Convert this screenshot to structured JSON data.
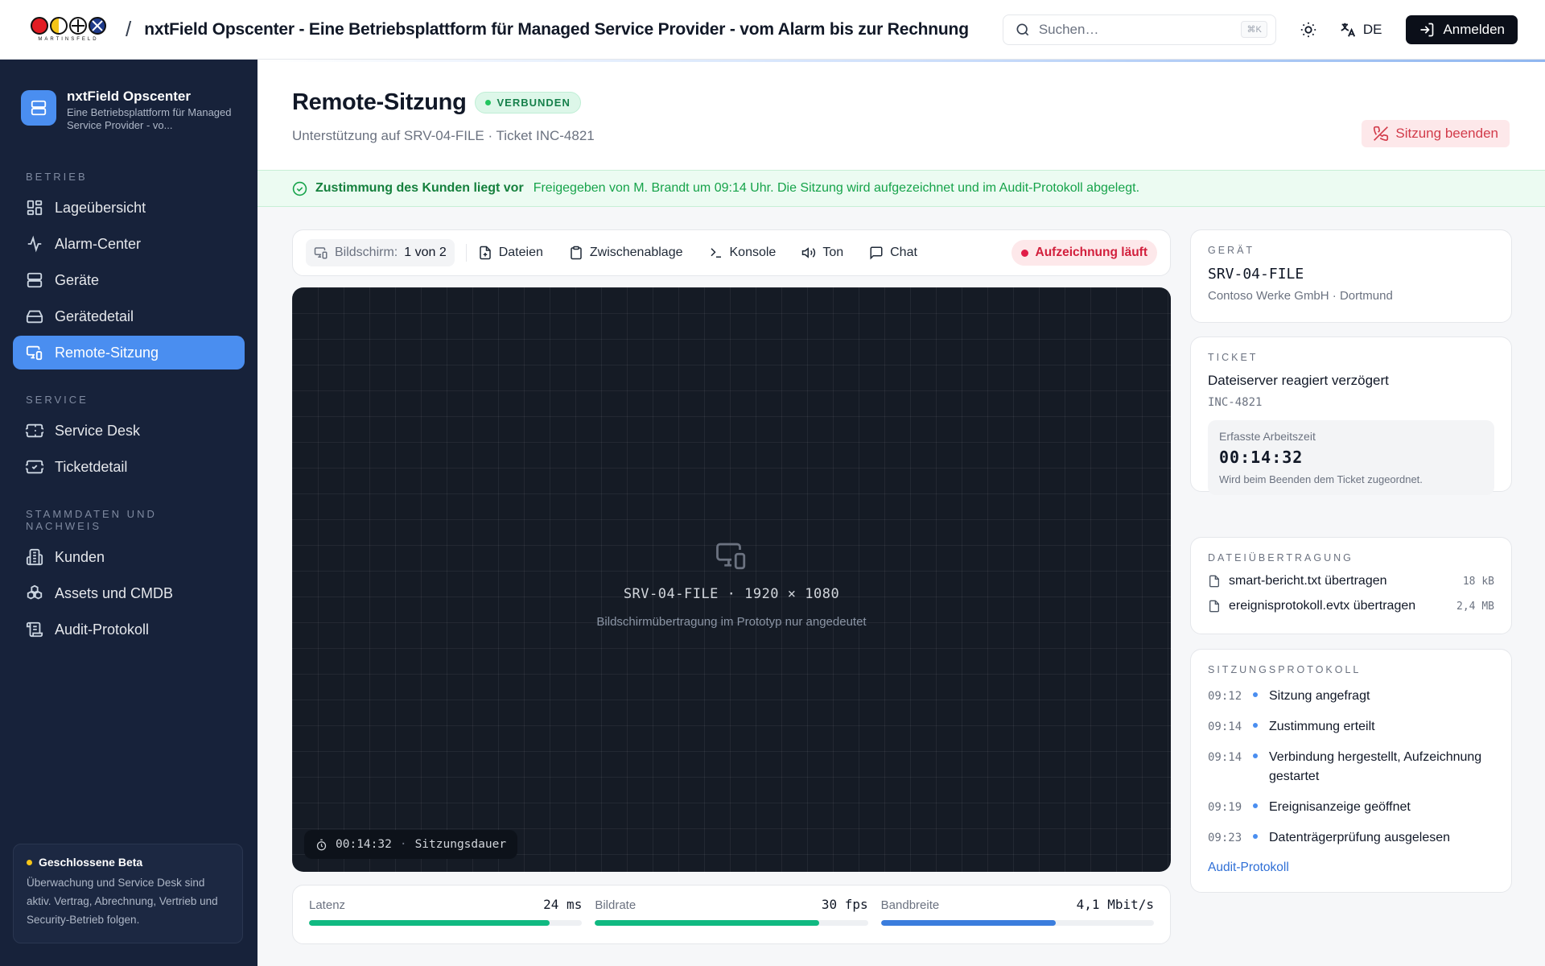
{
  "topbar": {
    "logo_text": "MARTINSFELD",
    "title": "nxtField Opscenter - Eine Betriebsplattform für Managed Service Provider - vom Alarm bis zur Rechnung",
    "search_placeholder": "Suchen…",
    "search_shortcut": "⌘K",
    "language": "DE",
    "login_label": "Anmelden"
  },
  "sidebar": {
    "brand_title": "nxtField Opscenter",
    "brand_subtitle": "Eine Betriebsplattform für Managed Service Provider - vo...",
    "sections": [
      {
        "title": "BETRIEB",
        "items": [
          {
            "label": "Lageübersicht",
            "icon": "dashboard-icon"
          },
          {
            "label": "Alarm-Center",
            "icon": "activity-icon"
          },
          {
            "label": "Geräte",
            "icon": "server-icon"
          },
          {
            "label": "Gerätedetail",
            "icon": "drive-icon"
          },
          {
            "label": "Remote-Sitzung",
            "icon": "monitor-smartphone-icon",
            "active": true
          }
        ]
      },
      {
        "title": "SERVICE",
        "items": [
          {
            "label": "Service Desk",
            "icon": "ticket-icon"
          },
          {
            "label": "Ticketdetail",
            "icon": "ticket-check-icon"
          }
        ]
      },
      {
        "title": "STAMMDATEN UND NACHWEIS",
        "items": [
          {
            "label": "Kunden",
            "icon": "building-icon"
          },
          {
            "label": "Assets und CMDB",
            "icon": "boxes-icon"
          },
          {
            "label": "Audit-Protokoll",
            "icon": "scroll-icon"
          }
        ]
      }
    ],
    "beta": {
      "title": "Geschlossene Beta",
      "text": "Überwachung und Service Desk sind aktiv. Vertrag, Abrechnung, Vertrieb und Security-Betrieb folgen."
    }
  },
  "page": {
    "title": "Remote-Sitzung",
    "status": "VERBUNDEN",
    "subtitle": "Unterstützung auf SRV-04-FILE · Ticket INC-4821",
    "end_button": "Sitzung beenden",
    "consent_title": "Zustimmung des Kunden liegt vor",
    "consent_text": "Freigegeben von M. Brandt um 09:14 Uhr. Die Sitzung wird aufgezeichnet und im Audit-Protokoll abgelegt."
  },
  "toolbar": {
    "screen_label": "Bildschirm:",
    "screen_value": "1 von 2",
    "files": "Dateien",
    "clipboard": "Zwischenablage",
    "console": "Konsole",
    "sound": "Ton",
    "chat": "Chat",
    "recording": "Aufzeichnung läuft"
  },
  "screen": {
    "device_info": "SRV-04-FILE · 1920 × 1080",
    "note": "Bildschirmübertragung im Prototyp nur angedeutet",
    "timer": "00:14:32",
    "timer_label": "Sitzungsdauer"
  },
  "metrics": [
    {
      "label": "Latenz",
      "value": "24 ms",
      "fill": 0.88,
      "color": "#10b981"
    },
    {
      "label": "Bildrate",
      "value": "30 fps",
      "fill": 0.82,
      "color": "#10b981"
    },
    {
      "label": "Bandbreite",
      "value": "4,1 Mbit/s",
      "fill": 0.64,
      "color": "#3b7ddd"
    }
  ],
  "device_card": {
    "label": "GERÄT",
    "name": "SRV-04-FILE",
    "location": "Contoso Werke GmbH · Dortmund"
  },
  "ticket_card": {
    "label": "TICKET",
    "title": "Dateiserver reagiert verzögert",
    "id": "INC-4821",
    "worktime_label": "Erfasste Arbeitszeit",
    "worktime_value": "00:14:32",
    "worktime_note": "Wird beim Beenden dem Ticket zugeordnet."
  },
  "transfer_card": {
    "label": "DATEIÜBERTRAGUNG",
    "files": [
      {
        "name": "smart-bericht.txt übertragen",
        "size": "18 kB"
      },
      {
        "name": "ereignisprotokoll.evtx übertragen",
        "size": "2,4 MB"
      }
    ]
  },
  "log_card": {
    "label": "SITZUNGSPROTOKOLL",
    "entries": [
      {
        "time": "09:12",
        "text": "Sitzung angefragt"
      },
      {
        "time": "09:14",
        "text": "Zustimmung erteilt"
      },
      {
        "time": "09:14",
        "text": "Verbindung hergestellt, Aufzeichnung gestartet"
      },
      {
        "time": "09:19",
        "text": "Ereignisanzeige geöffnet"
      },
      {
        "time": "09:23",
        "text": "Datenträgerprüfung ausgelesen"
      }
    ],
    "link": "Audit-Protokoll"
  }
}
